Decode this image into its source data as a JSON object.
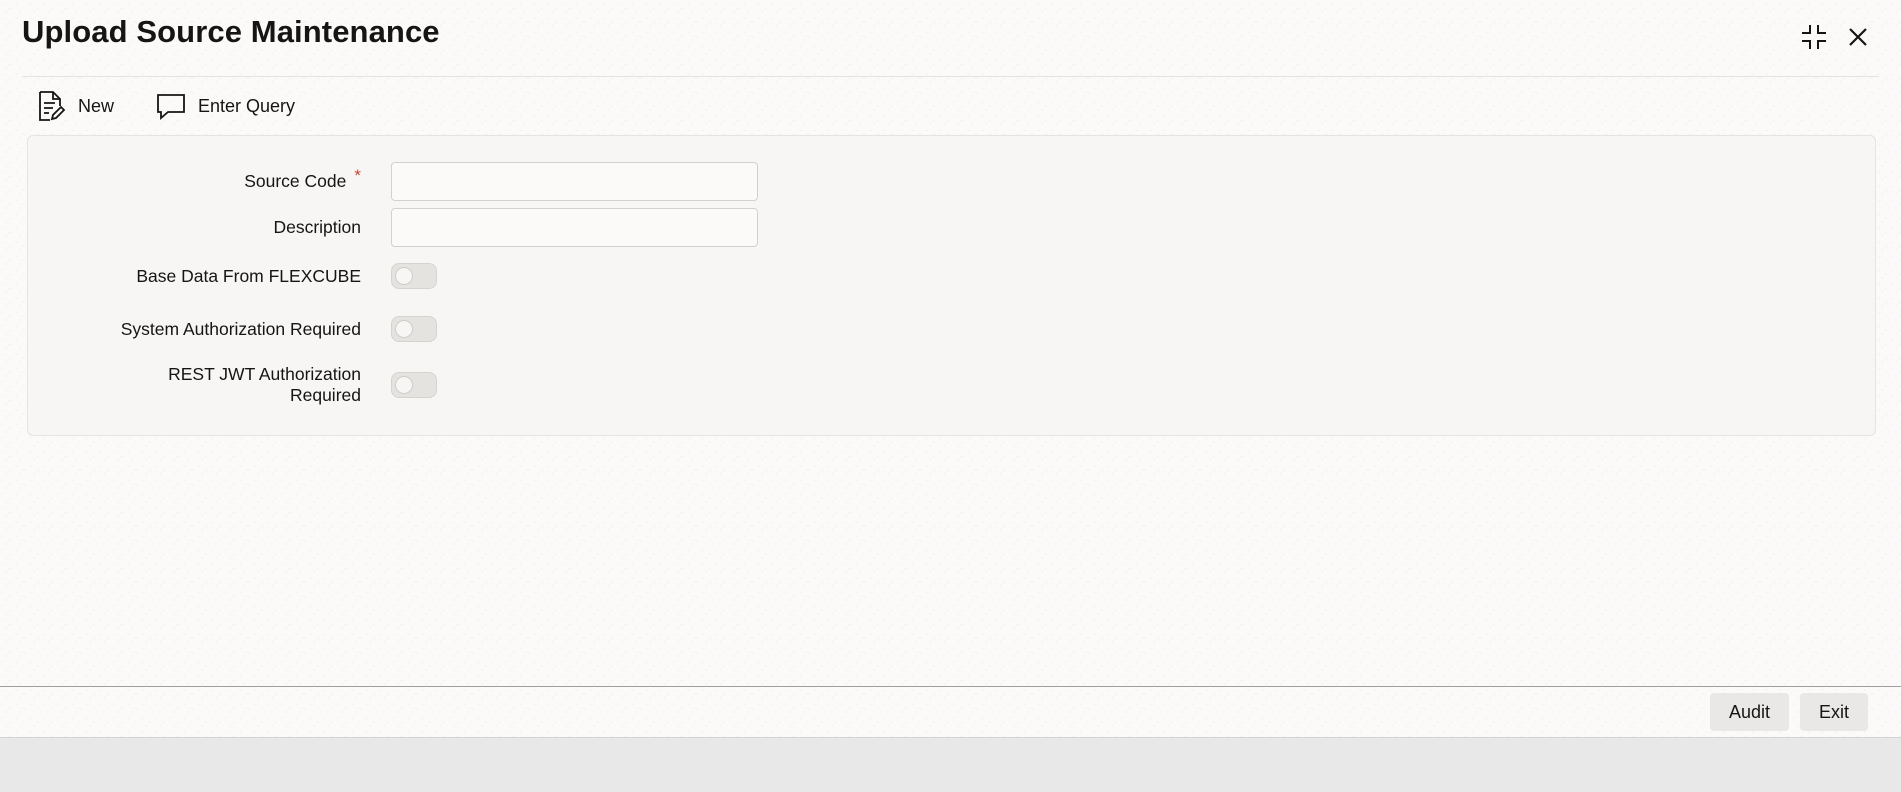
{
  "window": {
    "title": "Upload Source Maintenance",
    "controls": [
      {
        "name": "collapse-icon",
        "icon": "collapse-icon"
      },
      {
        "name": "close-icon",
        "icon": "close-icon"
      }
    ]
  },
  "toolbar": {
    "new_label": "New",
    "new_icon": "document-edit-icon",
    "query_label": "Enter Query",
    "query_icon": "speech-bubble-icon"
  },
  "form": {
    "source_code": {
      "label": "Source Code",
      "required_mark": "*",
      "value": ""
    },
    "description": {
      "label": "Description",
      "value": ""
    },
    "base_data": {
      "label": "Base Data From FLEXCUBE",
      "checked": false
    },
    "system_auth": {
      "label": "System Authorization Required",
      "checked": false
    },
    "rest_jwt": {
      "label_line1": "REST JWT Authorization",
      "label_line2": "Required",
      "checked": false
    }
  },
  "footer": {
    "audit_label": "Audit",
    "exit_label": "Exit"
  },
  "colors": {
    "required": "#c74634",
    "panel": "#f7f6f4",
    "button": "#e9e8e6"
  }
}
